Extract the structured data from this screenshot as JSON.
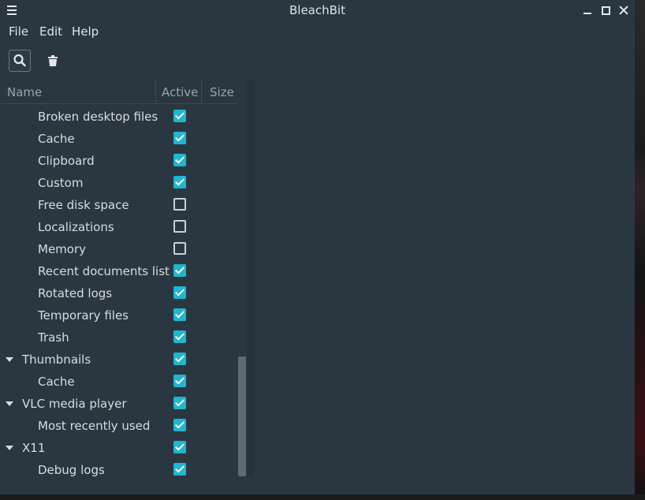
{
  "window": {
    "title": "BleachBit"
  },
  "menu": {
    "items": [
      "File",
      "Edit",
      "Help"
    ]
  },
  "toolbar": {
    "preview_icon": "search-icon",
    "clean_icon": "trash-icon"
  },
  "tree": {
    "columns": [
      "Name",
      "Active",
      "Size"
    ],
    "rows": [
      {
        "label": "Broken desktop files",
        "level": 1,
        "checked": true
      },
      {
        "label": "Cache",
        "level": 1,
        "checked": true
      },
      {
        "label": "Clipboard",
        "level": 1,
        "checked": true
      },
      {
        "label": "Custom",
        "level": 1,
        "checked": true
      },
      {
        "label": "Free disk space",
        "level": 1,
        "checked": false
      },
      {
        "label": "Localizations",
        "level": 1,
        "checked": false
      },
      {
        "label": "Memory",
        "level": 1,
        "checked": false
      },
      {
        "label": "Recent documents list",
        "level": 1,
        "checked": true
      },
      {
        "label": "Rotated logs",
        "level": 1,
        "checked": true
      },
      {
        "label": "Temporary files",
        "level": 1,
        "checked": true
      },
      {
        "label": "Trash",
        "level": 1,
        "checked": true
      },
      {
        "label": "Thumbnails",
        "level": 0,
        "checked": true,
        "expanded": true
      },
      {
        "label": "Cache",
        "level": 1,
        "checked": true
      },
      {
        "label": "VLC media player",
        "level": 0,
        "checked": true,
        "expanded": true
      },
      {
        "label": "Most recently used",
        "level": 1,
        "checked": true
      },
      {
        "label": "X11",
        "level": 0,
        "checked": true,
        "expanded": true
      },
      {
        "label": "Debug logs",
        "level": 1,
        "checked": true
      }
    ]
  },
  "colors": {
    "window_bg": "#2b3740",
    "check_accent": "#1fb6cf"
  }
}
